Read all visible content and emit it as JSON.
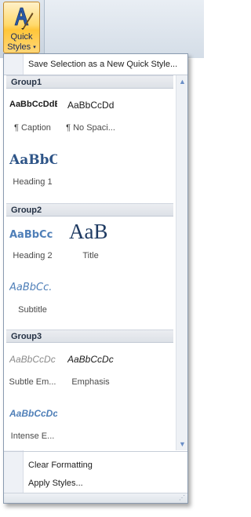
{
  "ribbon": {
    "quick_styles_line1": "Quick",
    "quick_styles_line2": "Styles",
    "dropdown_arrow": "▾"
  },
  "menu": {
    "save_selection": "Save Selection as a New Quick Style...",
    "clear_formatting": "Clear Formatting",
    "apply_styles": "Apply Styles..."
  },
  "groups": [
    {
      "name": "Group1",
      "styles": [
        {
          "sample": "AaBbCcDdE",
          "label": "¶ Caption"
        },
        {
          "sample": "AaBbCcDd",
          "label": "¶ No Spaci..."
        },
        {
          "sample": "AaBbCc",
          "label": "Heading 1"
        }
      ]
    },
    {
      "name": "Group2",
      "styles": [
        {
          "sample": "AaBbCc",
          "label": "Heading 2"
        },
        {
          "sample": "AaB",
          "label": "Title"
        },
        {
          "sample": "AaBbCc.",
          "label": "Subtitle"
        }
      ]
    },
    {
      "name": "Group3",
      "styles": [
        {
          "sample": "AaBbCcDc",
          "label": "Subtle Em..."
        },
        {
          "sample": "AaBbCcDc",
          "label": "Emphasis"
        },
        {
          "sample": "AaBbCcDc",
          "label": "Intense E..."
        }
      ]
    }
  ],
  "scrollbar": {
    "up": "▲",
    "down": "▼"
  },
  "grip": "⋰"
}
